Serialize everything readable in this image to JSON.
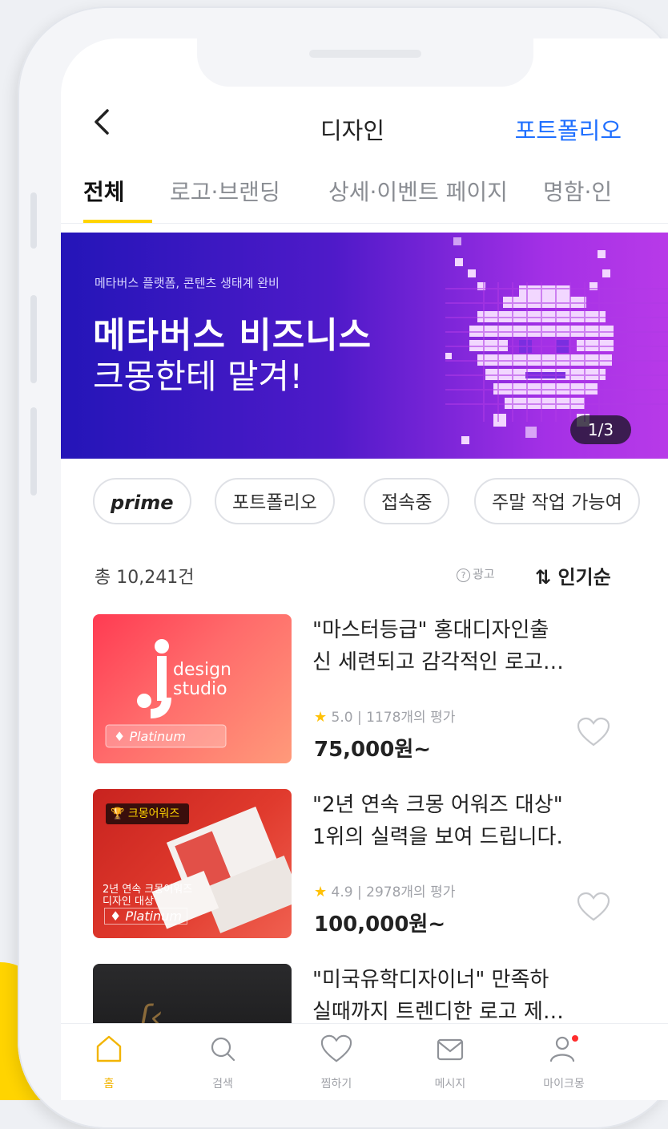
{
  "header": {
    "back_icon": "chevron-left-icon",
    "title": "디자인",
    "action_label": "포트폴리오"
  },
  "tabs": [
    {
      "label": "전체",
      "active": true
    },
    {
      "label": "로고·브랜딩",
      "active": false
    },
    {
      "label": "상세·이벤트 페이지",
      "active": false
    },
    {
      "label": "명함·인",
      "active": false
    }
  ],
  "banner": {
    "subtitle": "메타버스 플랫폼, 콘텐츠 생태계 완비",
    "headline": "메타버스 비즈니스",
    "headline2": "크몽한테 맡겨!",
    "page_indicator": "1/3"
  },
  "filters": [
    {
      "label": "prime"
    },
    {
      "label": "포트폴리오"
    },
    {
      "label": "접속중"
    },
    {
      "label": "주말 작업 가능여"
    }
  ],
  "list_header": {
    "count": "총 10,241건",
    "ad_label": "광고",
    "sort_label": "인기순"
  },
  "items": [
    {
      "title_line1": "\"마스터등급\" 홍대디자인출",
      "title_line2": "신 세련되고 감각적인 로고…",
      "rating": "5.0",
      "reviews": "| 1178개의 평가",
      "price": "75,000원~",
      "thumb": {
        "line1": "design",
        "line2": "studio",
        "badge": "Platinum"
      }
    },
    {
      "title_line1": "\"2년 연속 크몽 어워즈 대상\"",
      "title_line2": "1위의 실력을 보여 드립니다.",
      "rating": "4.9",
      "reviews": "| 2978개의 평가",
      "price": "100,000원~",
      "thumb": {
        "award": "크몽어워즈",
        "caption": "2년 연속 크몽어워즈",
        "caption2": "디자인 대상",
        "badge": "Platinum"
      }
    },
    {
      "title_line1": "\"미국유학디자이너\" 만족하",
      "title_line2": "실때까지 트렌디한 로고 제…"
    }
  ],
  "bottom_nav": [
    {
      "label": "홈",
      "icon": "home-icon",
      "active": true
    },
    {
      "label": "검색",
      "icon": "search-icon",
      "active": false
    },
    {
      "label": "찜하기",
      "icon": "heart-icon",
      "active": false
    },
    {
      "label": "메시지",
      "icon": "mail-icon",
      "active": false
    },
    {
      "label": "마이크몽",
      "icon": "user-icon",
      "active": false,
      "notification": true
    }
  ],
  "colors": {
    "accent": "#ffd400",
    "link": "#1f6fff",
    "banner_start": "#2415b8",
    "banner_end": "#b83ae8",
    "star": "#ffc107",
    "notification_dot": "#ff2d2d"
  }
}
